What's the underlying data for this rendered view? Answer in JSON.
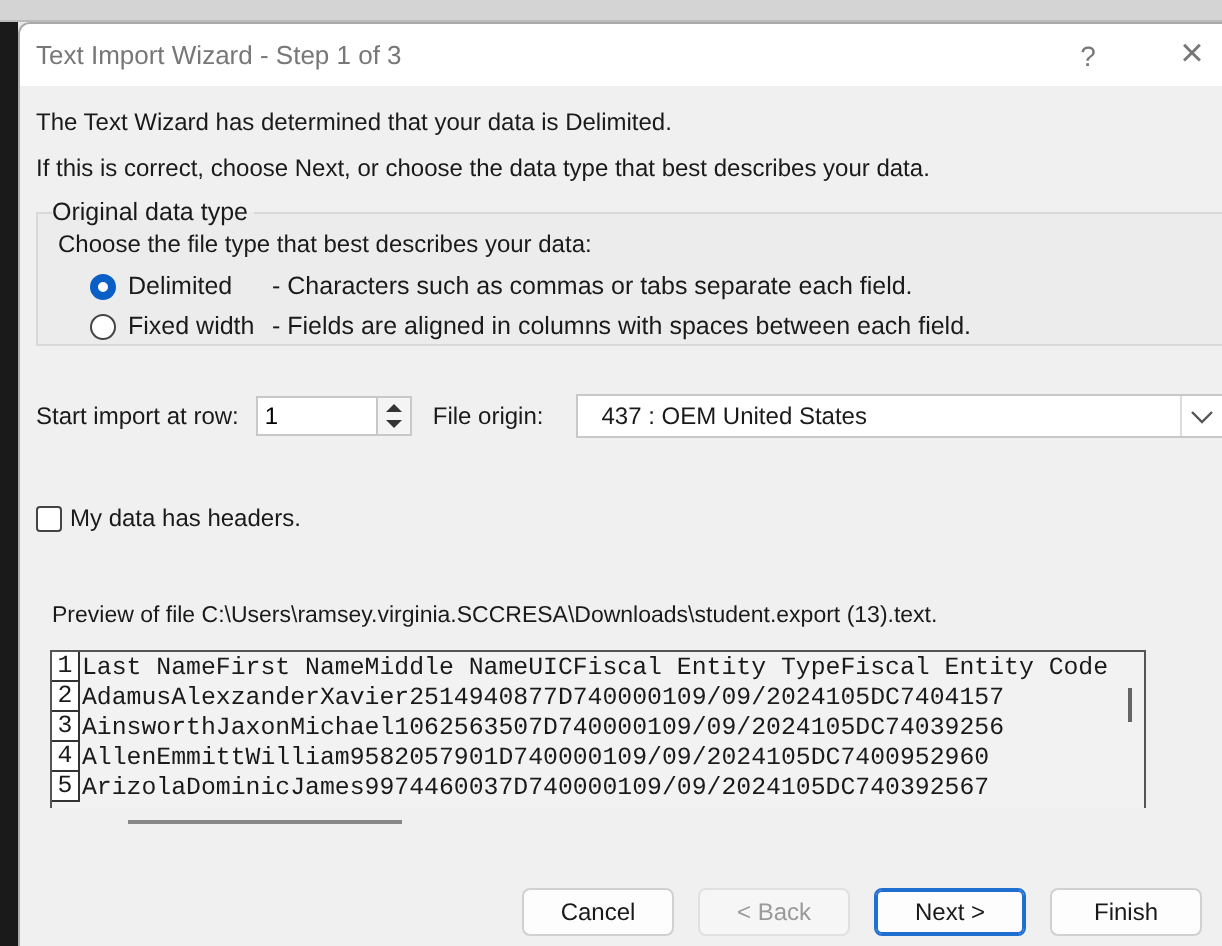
{
  "window": {
    "title": "Text Import Wizard - Step 1 of 3",
    "help": "?",
    "close": "×"
  },
  "intro": [
    "The Text Wizard has determined that your data is Delimited.",
    "If this is correct, choose Next, or choose the data type that best describes your data."
  ],
  "data_type_group": {
    "legend": "Original data type",
    "prompt": "Choose the file type that best describes your data:",
    "options": [
      {
        "label": "Delimited",
        "description": "- Characters such as commas or tabs separate each field.",
        "selected": true
      },
      {
        "label": "Fixed width",
        "description": "- Fields are aligned in columns with spaces between each field.",
        "selected": false
      }
    ]
  },
  "start_row": {
    "label": "Start import at row:",
    "value": "1"
  },
  "file_origin": {
    "label": "File origin:",
    "value": "437 : OEM United States"
  },
  "headers_checkbox": {
    "label": "My data has headers.",
    "checked": false
  },
  "preview": {
    "label": "Preview of file C:\\Users\\ramsey.virginia.SCCRESA\\Downloads\\student.export (13).text.",
    "lines": [
      {
        "number": "1",
        "text": "Last NameFirst NameMiddle NameUICFiscal Entity TypeFiscal Entity Code"
      },
      {
        "number": "2",
        "text": "AdamusAlexzanderXavier2514940877D740000109/09/2024105DC7404157"
      },
      {
        "number": "3",
        "text": "AinsworthJaxonMichael1062563507D740000109/09/2024105DC74039256"
      },
      {
        "number": "4",
        "text": "AllenEmmittWilliam9582057901D740000109/09/2024105DC7400952960"
      },
      {
        "number": "5",
        "text": "ArizolaDominicJames9974460037D740000109/09/2024105DC740392567"
      }
    ]
  },
  "buttons": [
    {
      "label": "Cancel",
      "disabled": false,
      "default": false
    },
    {
      "label": "< Back",
      "disabled": true,
      "default": false
    },
    {
      "label": "Next >",
      "disabled": false,
      "default": true
    },
    {
      "label": "Finish",
      "disabled": false,
      "default": false
    }
  ]
}
